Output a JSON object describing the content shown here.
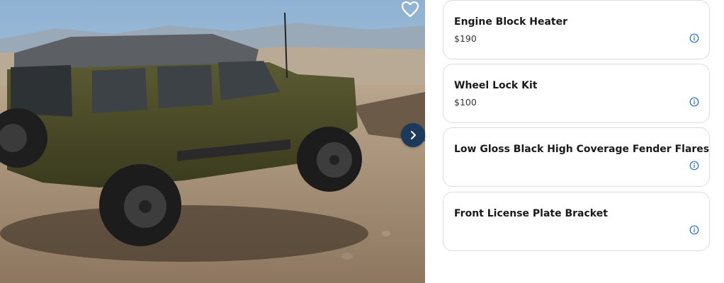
{
  "gallery": {
    "favorite_icon": "heart-outline-icon",
    "next_icon": "chevron-right-icon",
    "accent_color": "#1b3a5c"
  },
  "accessories": [
    {
      "title": "Engine Block Heater",
      "price": "$190",
      "icon": "info-icon"
    },
    {
      "title": "Wheel Lock Kit",
      "price": "$100",
      "icon": "info-icon"
    },
    {
      "title": "Low Gloss Black High Coverage Fender Flares",
      "price": "",
      "icon": "info-icon"
    },
    {
      "title": "Front License Plate Bracket",
      "price": "",
      "icon": "info-icon"
    }
  ]
}
